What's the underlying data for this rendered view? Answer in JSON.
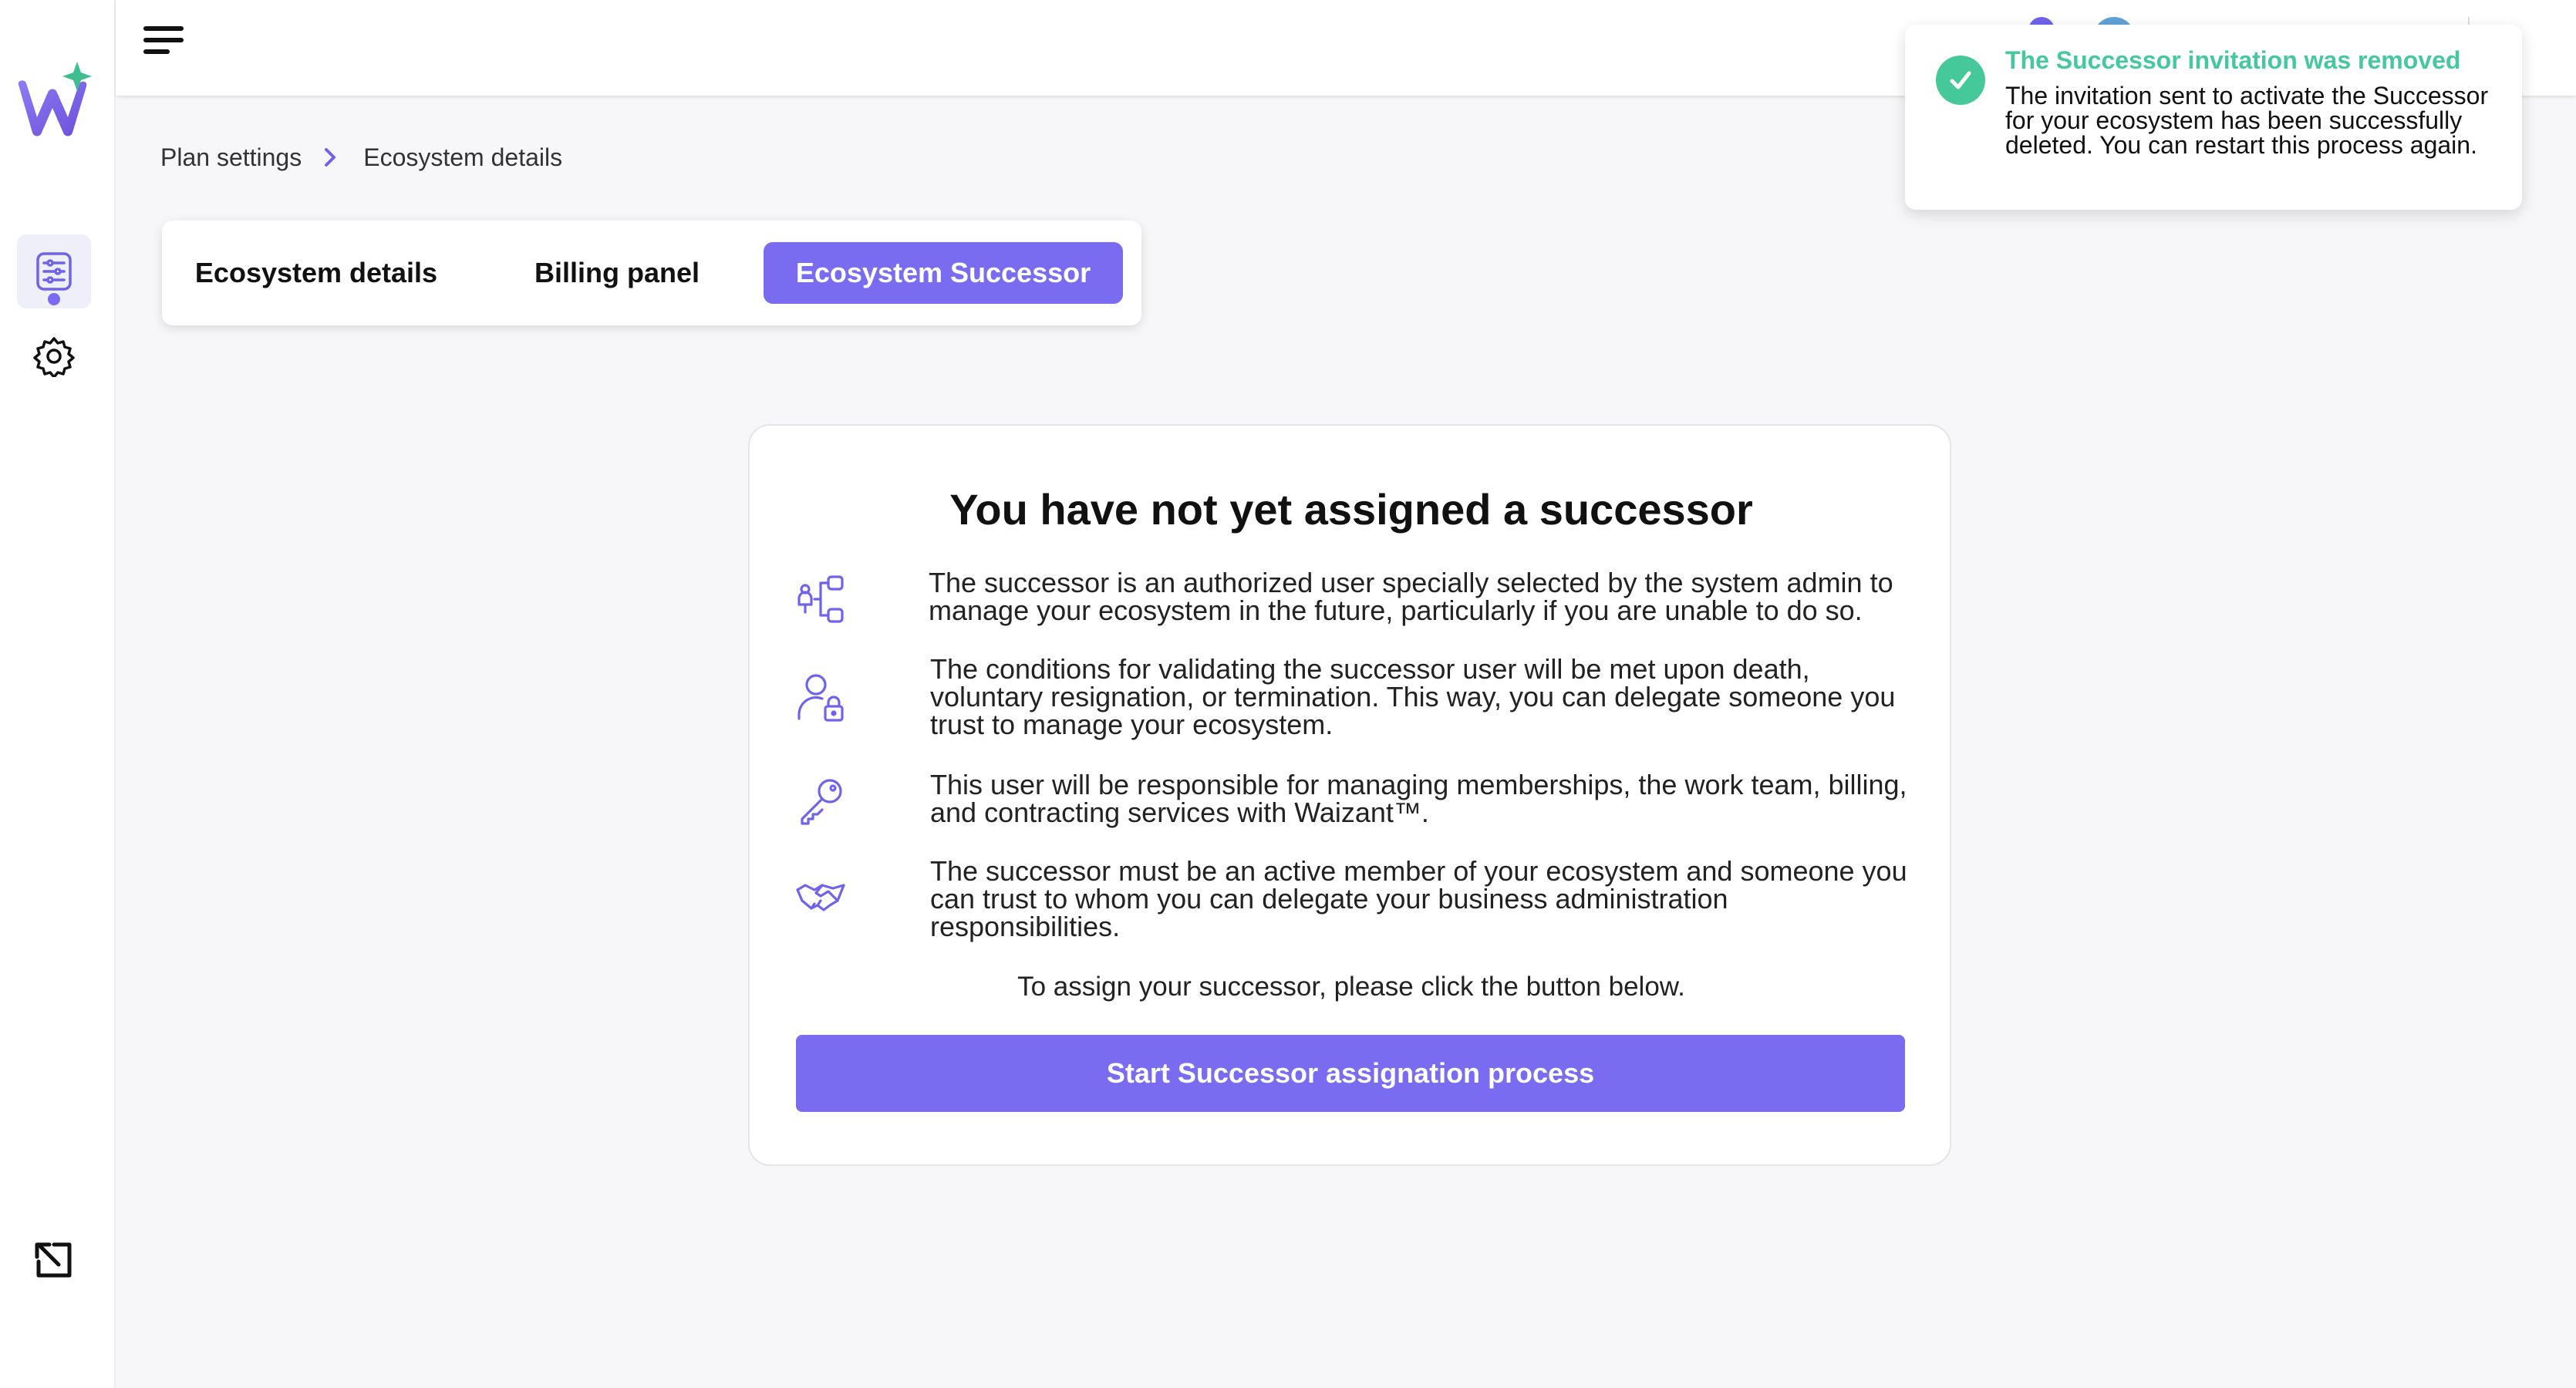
{
  "app": {
    "logo_icon": "waizant-logo",
    "brand_color": "#7a6cf0",
    "success_color": "#45c99a"
  },
  "sidebar": {
    "items": [
      {
        "icon": "settings-list-icon",
        "active": true
      },
      {
        "icon": "gear-icon",
        "active": false
      }
    ],
    "bottom_icon": "exit-arrow-icon"
  },
  "topbar": {
    "menu_icon": "hamburger-menu-icon"
  },
  "breadcrumb": {
    "items": [
      "Plan settings",
      "Ecosystem details"
    ],
    "separator_icon": "chevron-right-icon"
  },
  "tabs": [
    {
      "label": "Ecosystem details",
      "active": false
    },
    {
      "label": "Billing panel",
      "active": false
    },
    {
      "label": "Ecosystem Successor",
      "active": true
    }
  ],
  "successor_card": {
    "title": "You have not yet assigned a successor",
    "items": [
      {
        "icon": "hierarchy-user-icon",
        "text": "The successor is an authorized user specially selected by the system admin to manage your ecosystem in the future, particularly if you are unable to do so."
      },
      {
        "icon": "user-lock-icon",
        "text": "The conditions for validating the successor user will be met upon death, voluntary resignation, or termination. This way, you can delegate someone you trust to manage your ecosystem."
      },
      {
        "icon": "key-icon",
        "text": "This user will be responsible for managing memberships, the work team, billing, and contracting services with Waizant™."
      },
      {
        "icon": "handshake-icon",
        "text": "The successor must be an active member of your ecosystem and someone you can trust to whom you can delegate your business administration responsibilities."
      }
    ],
    "note": "To assign your successor, please click the button below.",
    "cta_label": "Start Successor assignation process"
  },
  "toast": {
    "icon": "check-circle-icon",
    "title": "The Successor invitation was removed",
    "body": "The invitation sent to activate the Successor for your ecosystem has been successfully deleted. You can restart this process again."
  }
}
